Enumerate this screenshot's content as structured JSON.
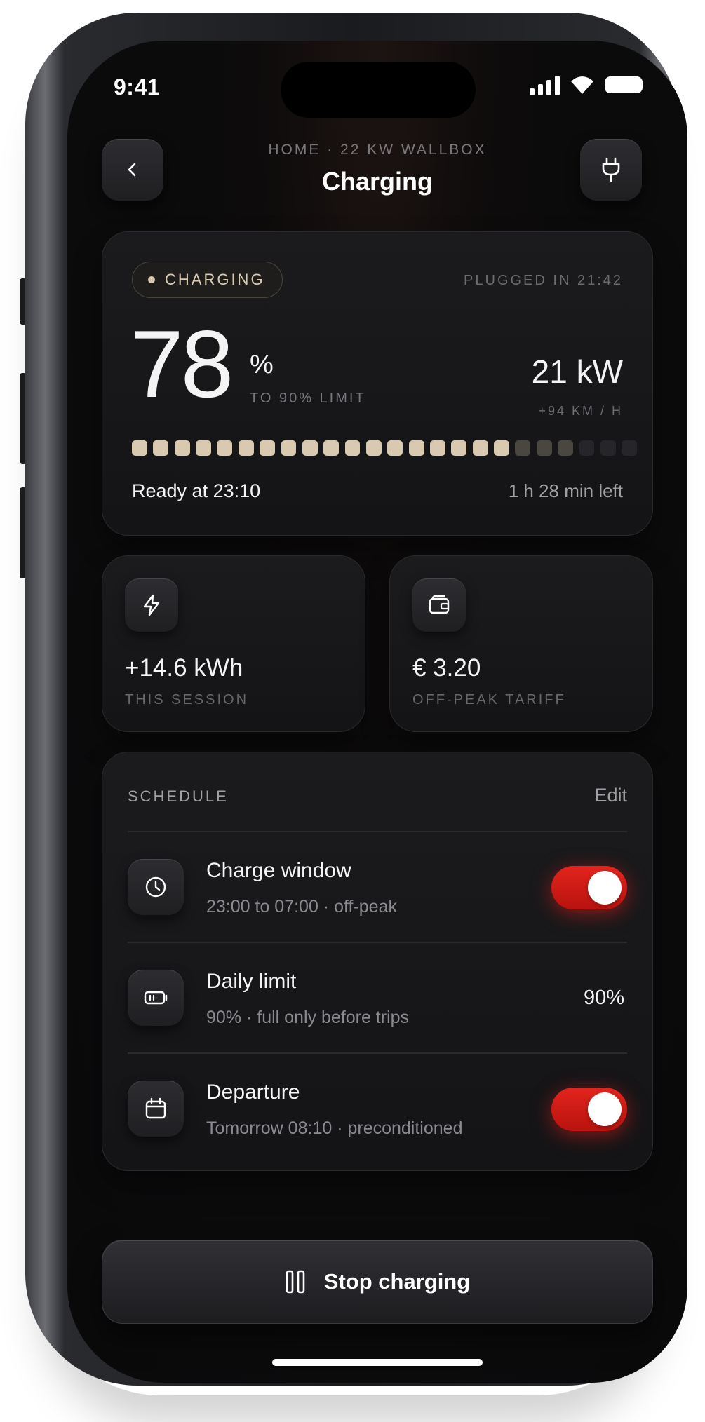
{
  "status_bar": {
    "time": "9:41"
  },
  "header": {
    "eyebrow": "HOME · 22 KW WALLBOX",
    "title": "Charging"
  },
  "charge_card": {
    "status_pill": "CHARGING",
    "plugged_in": "PLUGGED IN 21:42",
    "percent": "78",
    "percent_sign": "%",
    "limit_label": "TO 90% LIMIT",
    "power": "21 kW",
    "rate": "+94 KM / H",
    "ready_at": "Ready at 23:10",
    "time_left": "1 h 28 min left",
    "segments_total": 24,
    "segments_filled": 18,
    "segments_dim": 3
  },
  "stats": [
    {
      "icon": "lightning-icon",
      "value": "+14.6 kWh",
      "label": "THIS SESSION"
    },
    {
      "icon": "wallet-icon",
      "value": "€ 3.20",
      "label": "OFF-PEAK TARIFF"
    }
  ],
  "schedule": {
    "heading": "SCHEDULE",
    "edit_label": "Edit",
    "rows": [
      {
        "icon": "clock-icon",
        "title": "Charge window",
        "subtitle": "23:00 to 07:00 · off-peak",
        "toggle_on": true
      },
      {
        "icon": "battery-icon",
        "title": "Daily limit",
        "subtitle": "90% · full only before trips",
        "value": "90%"
      },
      {
        "icon": "calendar-icon",
        "title": "Departure",
        "subtitle": "Tomorrow 08:10 · preconditioned",
        "toggle_on": true
      }
    ]
  },
  "action": {
    "stop_label": "Stop charging"
  },
  "colors": {
    "accent_red": "#e3241d",
    "segment_filled": "#d8c9b0",
    "segment_dim": "#4a4640",
    "segment_empty": "#26262a"
  }
}
